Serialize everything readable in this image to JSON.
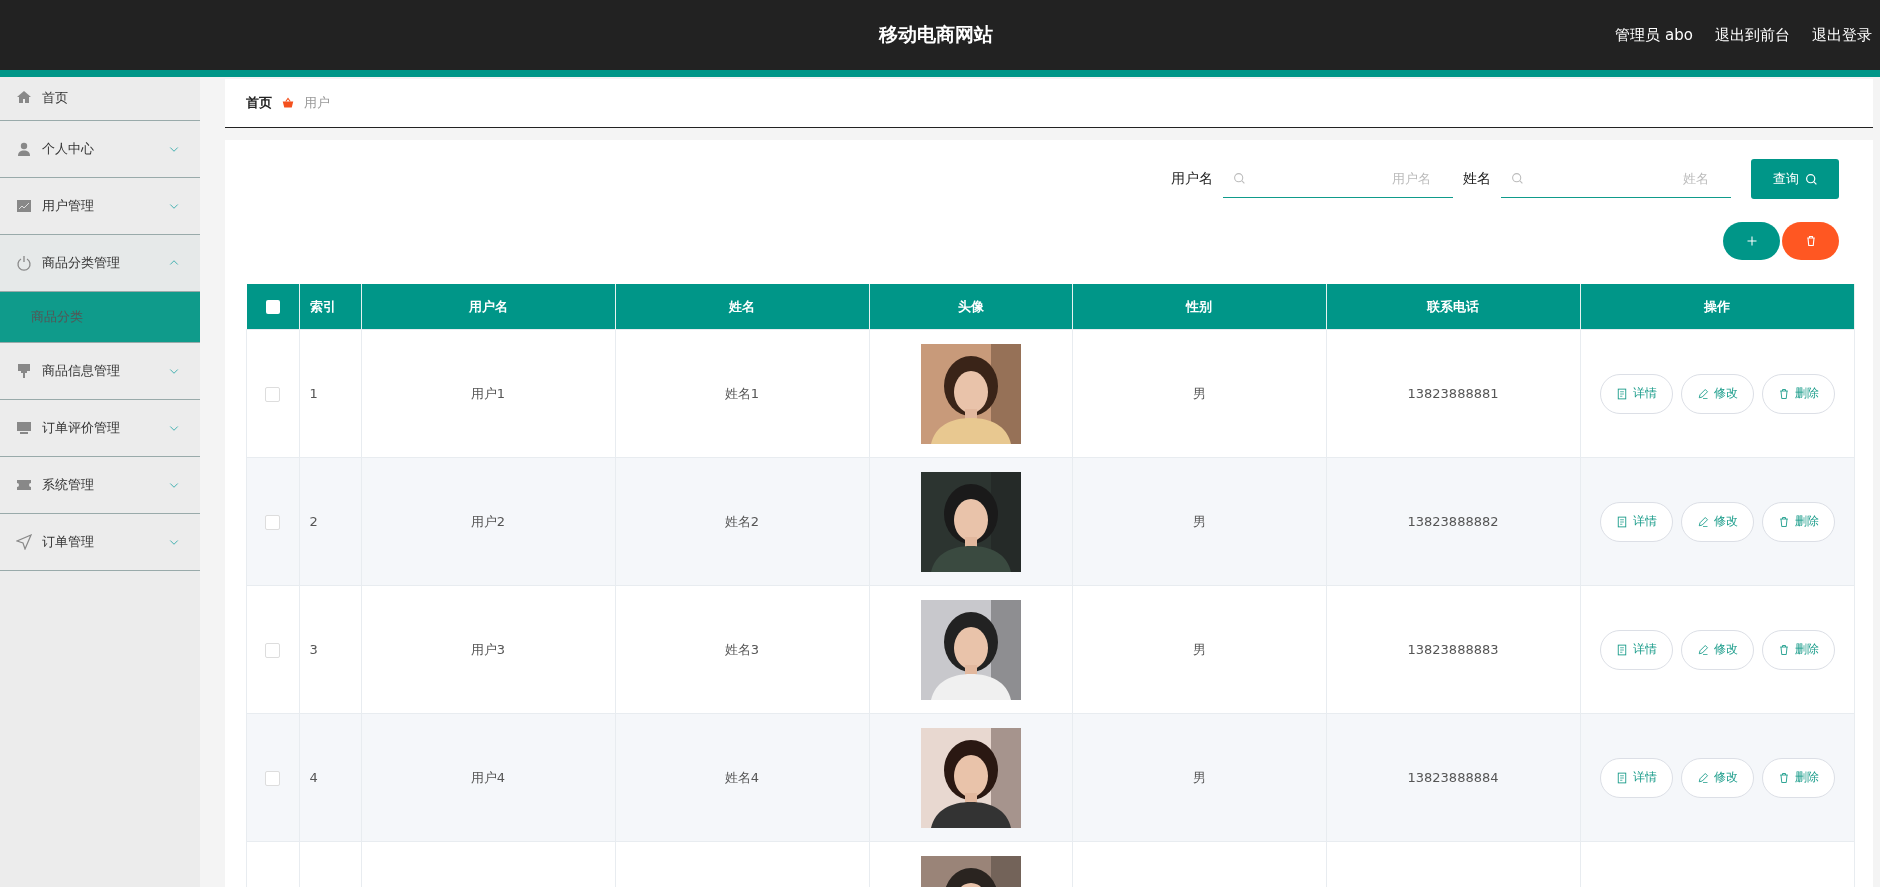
{
  "header": {
    "title": "移动电商网站",
    "links": [
      "管理员 abo",
      "退出到前台",
      "退出登录"
    ]
  },
  "sidebar": {
    "items": [
      {
        "label": "首页"
      },
      {
        "label": "个人中心",
        "expanded": false
      },
      {
        "label": "用户管理",
        "expanded": false
      },
      {
        "label": "商品分类管理",
        "expanded": true,
        "children": [
          {
            "label": "商品分类",
            "selected": true
          }
        ]
      },
      {
        "label": "商品信息管理",
        "expanded": false
      },
      {
        "label": "订单评价管理",
        "expanded": false
      },
      {
        "label": "系统管理",
        "expanded": false
      },
      {
        "label": "订单管理",
        "expanded": false
      }
    ]
  },
  "breadcrumb": [
    "首页",
    "用户"
  ],
  "search": {
    "fields": [
      {
        "label": "用户名",
        "placeholder": "用户名"
      },
      {
        "label": "姓名",
        "placeholder": "姓名"
      }
    ],
    "button": "查询"
  },
  "table": {
    "select_all_checked": false,
    "columns": [
      "索引",
      "用户名",
      "姓名",
      "头像",
      "性别",
      "联系电话",
      "操作"
    ],
    "rows": [
      {
        "checked": false,
        "index": "1",
        "username": "用户1",
        "name": "姓名1",
        "avatar": {
          "kind": "picture"
        },
        "gender": "男",
        "phone": "13823888881",
        "actions": [
          "详情",
          "修改",
          "删除"
        ]
      },
      {
        "checked": false,
        "index": "2",
        "username": "用户2",
        "name": "姓名2",
        "avatar": {
          "kind": "picture"
        },
        "gender": "男",
        "phone": "13823888882",
        "actions": [
          "详情",
          "修改",
          "删除"
        ]
      },
      {
        "checked": false,
        "index": "3",
        "username": "用户3",
        "name": "姓名3",
        "avatar": {
          "kind": "picture"
        },
        "gender": "男",
        "phone": "13823888883",
        "actions": [
          "详情",
          "修改",
          "删除"
        ]
      },
      {
        "checked": false,
        "index": "4",
        "username": "用户4",
        "name": "姓名4",
        "avatar": {
          "kind": "picture"
        },
        "gender": "男",
        "phone": "13823888884",
        "actions": [
          "详情",
          "修改",
          "删除"
        ]
      },
      {
        "avatar": {
          "kind": "picture"
        }
      }
    ]
  }
}
